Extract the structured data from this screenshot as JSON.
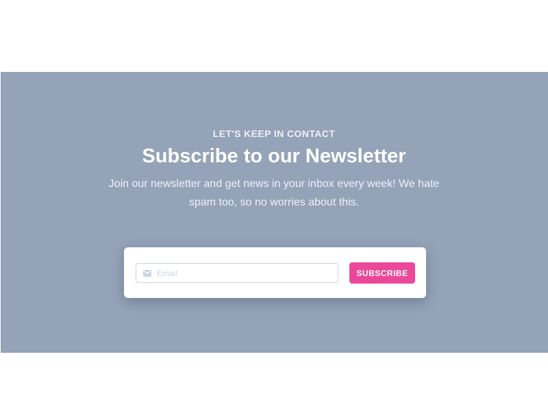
{
  "newsletter": {
    "eyebrow": "LET'S KEEP IN CONTACT",
    "title": "Subscribe to our Newsletter",
    "subtitle": "Join our newsletter and get news in your inbox every week! We hate spam too, so no worries about this.",
    "email_input": {
      "placeholder": "Email",
      "value": "",
      "icon": "envelope-icon"
    },
    "subscribe_label": "SUBSCRIBE"
  },
  "colors": {
    "band_background": "#94a3b8",
    "button_accent": "#ec4899",
    "card_background": "#ffffff"
  }
}
